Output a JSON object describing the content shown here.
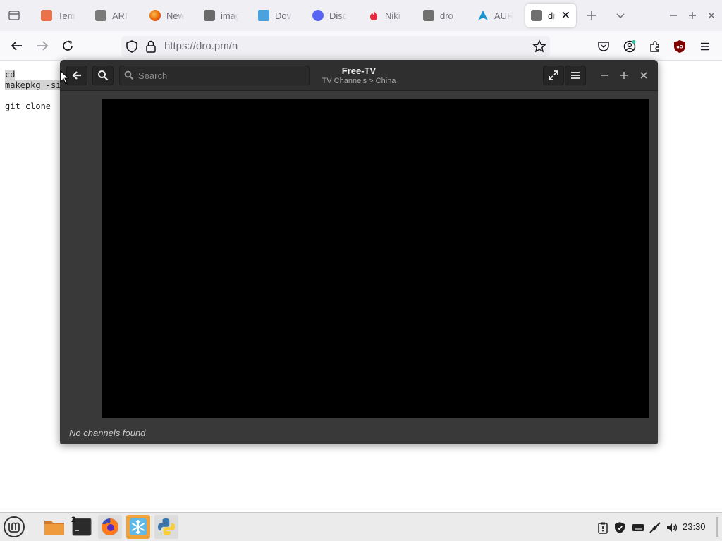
{
  "browser": {
    "tabs": [
      {
        "label": "Tem"
      },
      {
        "label": "ARI"
      },
      {
        "label": "New"
      },
      {
        "label": "imag"
      },
      {
        "label": "Dov"
      },
      {
        "label": "Disc"
      },
      {
        "label": "Niki"
      },
      {
        "label": "dro"
      },
      {
        "label": "AUR"
      },
      {
        "label": "dro",
        "active": true
      }
    ],
    "url": "https://dro.pm/n"
  },
  "webpage": {
    "lines": [
      "cd",
      "makepkg -si",
      "git clone"
    ]
  },
  "app": {
    "title": "Free-TV",
    "subtitle": "TV Channels > China",
    "search_placeholder": "Search",
    "status": "No channels found"
  },
  "taskbar": {
    "terminal_badge": "2",
    "clock": "23:30"
  },
  "colors": {
    "app_bg": "#393939",
    "app_header": "#2f2f2f",
    "video": "#000000",
    "taskbar": "#ebebeb"
  }
}
